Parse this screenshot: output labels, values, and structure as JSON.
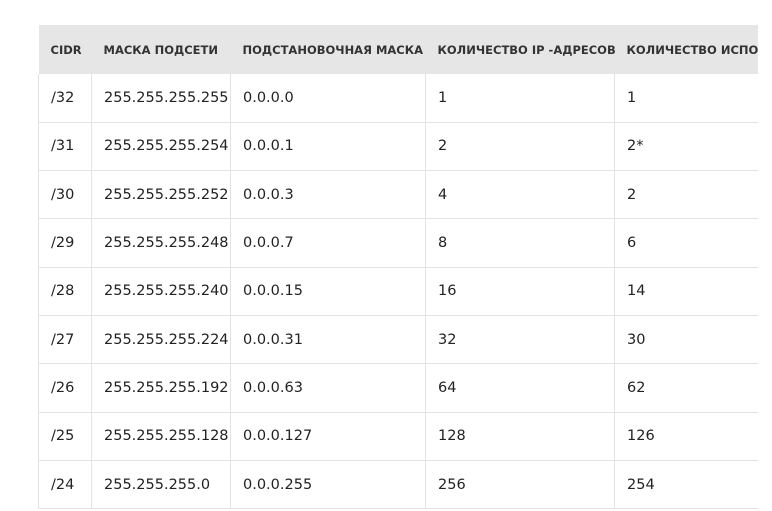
{
  "table": {
    "headers": [
      "CIDR",
      "МАСКА ПОДСЕТИ",
      "ПОДСТАНОВОЧНАЯ МАСКА",
      "КОЛИЧЕСТВО IP -АДРЕСОВ",
      "КОЛИЧЕСТВО ИСПОЛ"
    ],
    "rows": [
      [
        "/32",
        "255.255.255.255",
        "0.0.0.0",
        "1",
        "1"
      ],
      [
        "/31",
        "255.255.255.254",
        "0.0.0.1",
        "2",
        "2*"
      ],
      [
        "/30",
        "255.255.255.252",
        "0.0.0.3",
        "4",
        "2"
      ],
      [
        "/29",
        "255.255.255.248",
        "0.0.0.7",
        "8",
        "6"
      ],
      [
        "/28",
        "255.255.255.240",
        "0.0.0.15",
        "16",
        "14"
      ],
      [
        "/27",
        "255.255.255.224",
        "0.0.0.31",
        "32",
        "30"
      ],
      [
        "/26",
        "255.255.255.192",
        "0.0.0.63",
        "64",
        "62"
      ],
      [
        "/25",
        "255.255.255.128",
        "0.0.0.127",
        "128",
        "126"
      ],
      [
        "/24",
        "255.255.255.0",
        "0.0.0.255",
        "256",
        "254"
      ]
    ]
  },
  "colors": {
    "header_bg": "#e6e6e6",
    "border": "#e3e3e3",
    "text": "#222222"
  }
}
